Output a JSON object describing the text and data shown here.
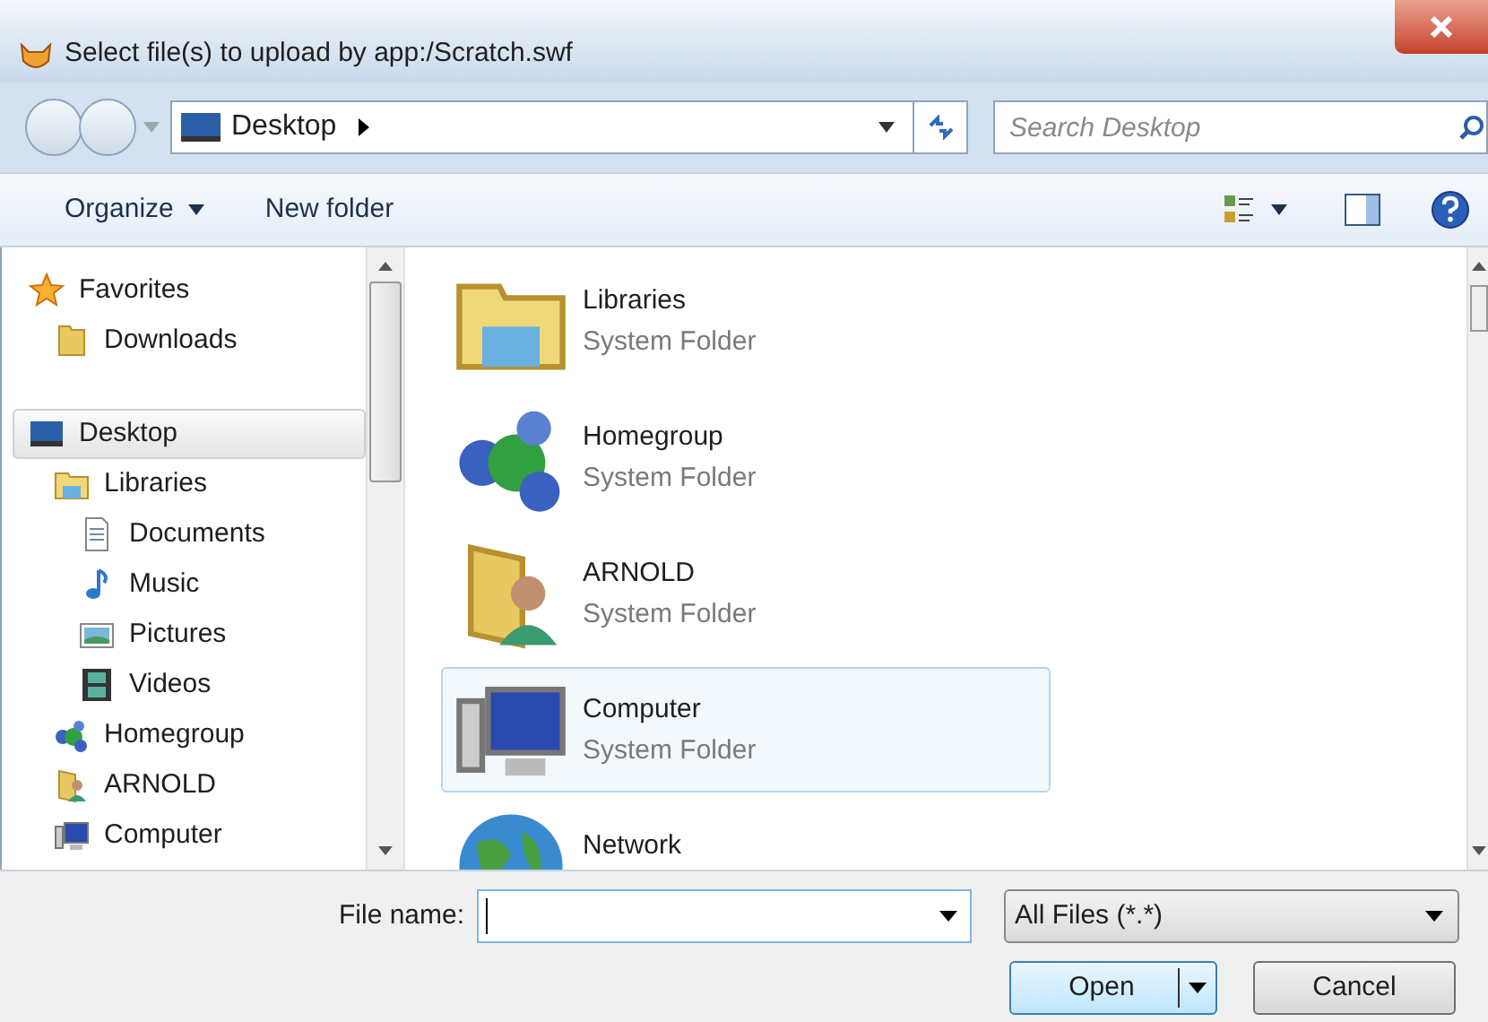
{
  "window": {
    "title": "Select file(s) to upload by app:/Scratch.swf"
  },
  "address_bar": {
    "location": "Desktop"
  },
  "search": {
    "placeholder": "Search Desktop"
  },
  "toolbar": {
    "organize": "Organize",
    "new_folder": "New folder"
  },
  "navigation": [
    {
      "label": "Favorites",
      "kind": "star",
      "selected": false,
      "children": [
        {
          "label": "Downloads",
          "kind": "folder",
          "selected": false
        }
      ]
    },
    {
      "label": "Desktop",
      "kind": "desktop",
      "selected": true,
      "children": [
        {
          "label": "Libraries",
          "kind": "libraries",
          "selected": false,
          "children": [
            {
              "label": "Documents",
              "kind": "document",
              "selected": false
            },
            {
              "label": "Music",
              "kind": "music",
              "selected": false
            },
            {
              "label": "Pictures",
              "kind": "picture",
              "selected": false
            },
            {
              "label": "Videos",
              "kind": "video",
              "selected": false
            }
          ]
        },
        {
          "label": "Homegroup",
          "kind": "homegroup",
          "selected": false
        },
        {
          "label": "ARNOLD",
          "kind": "user",
          "selected": false
        },
        {
          "label": "Computer",
          "kind": "computer",
          "selected": false
        }
      ]
    }
  ],
  "items": [
    {
      "name": "Libraries",
      "type": "System Folder",
      "kind": "libraries",
      "selected": false
    },
    {
      "name": "Homegroup",
      "type": "System Folder",
      "kind": "homegroup",
      "selected": false
    },
    {
      "name": "ARNOLD",
      "type": "System Folder",
      "kind": "user",
      "selected": false
    },
    {
      "name": "Computer",
      "type": "System Folder",
      "kind": "computer",
      "selected": true
    },
    {
      "name": "Network",
      "kind": "network",
      "selected": false
    }
  ],
  "file_name": {
    "label": "File name:"
  },
  "file_type": {
    "value": "All Files (*.*)"
  },
  "buttons": {
    "open": "Open",
    "cancel": "Cancel"
  }
}
